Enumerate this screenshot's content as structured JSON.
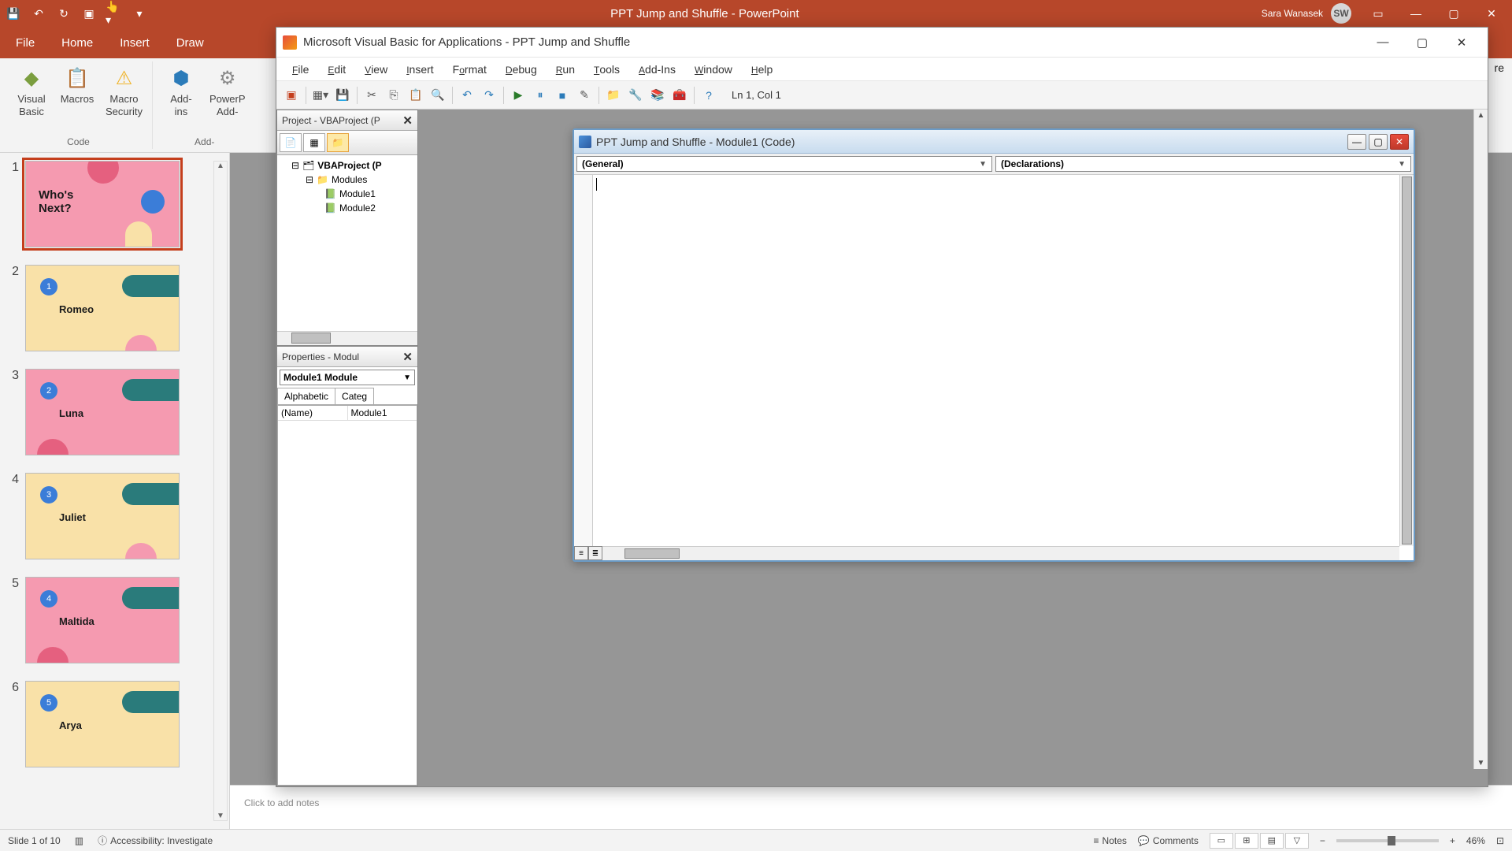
{
  "powerpoint": {
    "title": "PPT Jump and Shuffle  -  PowerPoint",
    "user_name": "Sara Wanasek",
    "user_initials": "SW",
    "tabs": [
      "File",
      "Home",
      "Insert",
      "Draw"
    ],
    "share": "re",
    "ribbon": {
      "group_code": "Code",
      "visual_basic": "Visual\nBasic",
      "macros": "Macros",
      "macro_security": "Macro\nSecurity",
      "addins": "Add-\nins",
      "powerpoint_addins": "PowerP\nAdd-"
    },
    "slides": [
      {
        "num": "1",
        "bg": "pink",
        "title": "Who's\nNext?",
        "selected": true
      },
      {
        "num": "2",
        "bg": "yellow",
        "title": "Romeo",
        "badge": "1"
      },
      {
        "num": "3",
        "bg": "pink",
        "title": "Luna",
        "badge": "2"
      },
      {
        "num": "4",
        "bg": "yellow",
        "title": "Juliet",
        "badge": "3"
      },
      {
        "num": "5",
        "bg": "pink",
        "title": "Maltida",
        "badge": "4"
      },
      {
        "num": "6",
        "bg": "yellow",
        "title": "Arya",
        "badge": "5"
      }
    ],
    "notes_placeholder": "Click to add notes",
    "status": {
      "slide": "Slide 1 of 10",
      "accessibility": "Accessibility: Investigate",
      "notes": "Notes",
      "comments": "Comments",
      "zoom": "46%"
    }
  },
  "vba": {
    "title": "Microsoft Visual Basic for Applications - PPT Jump and Shuffle",
    "menus": [
      "File",
      "Edit",
      "View",
      "Insert",
      "Format",
      "Debug",
      "Run",
      "Tools",
      "Add-Ins",
      "Window",
      "Help"
    ],
    "cursor_pos": "Ln 1, Col 1",
    "project_pane": {
      "title": "Project - VBAProject (P",
      "root": "VBAProject (P",
      "modules_folder": "Modules",
      "modules": [
        "Module1",
        "Module2"
      ]
    },
    "properties_pane": {
      "title": "Properties - Modul",
      "combo": "Module1 Module",
      "tabs": [
        "Alphabetic",
        "Categ"
      ],
      "name_key": "(Name)",
      "name_val": "Module1"
    },
    "code_window": {
      "title": "PPT Jump and Shuffle - Module1 (Code)",
      "left_combo": "(General)",
      "right_combo": "(Declarations)"
    }
  },
  "colors": {
    "pp_accent": "#b7472a",
    "pink": "#f59ab0",
    "yellow": "#f9e1a8",
    "teal": "#2a7b7b",
    "blue": "#3b7dd8"
  }
}
